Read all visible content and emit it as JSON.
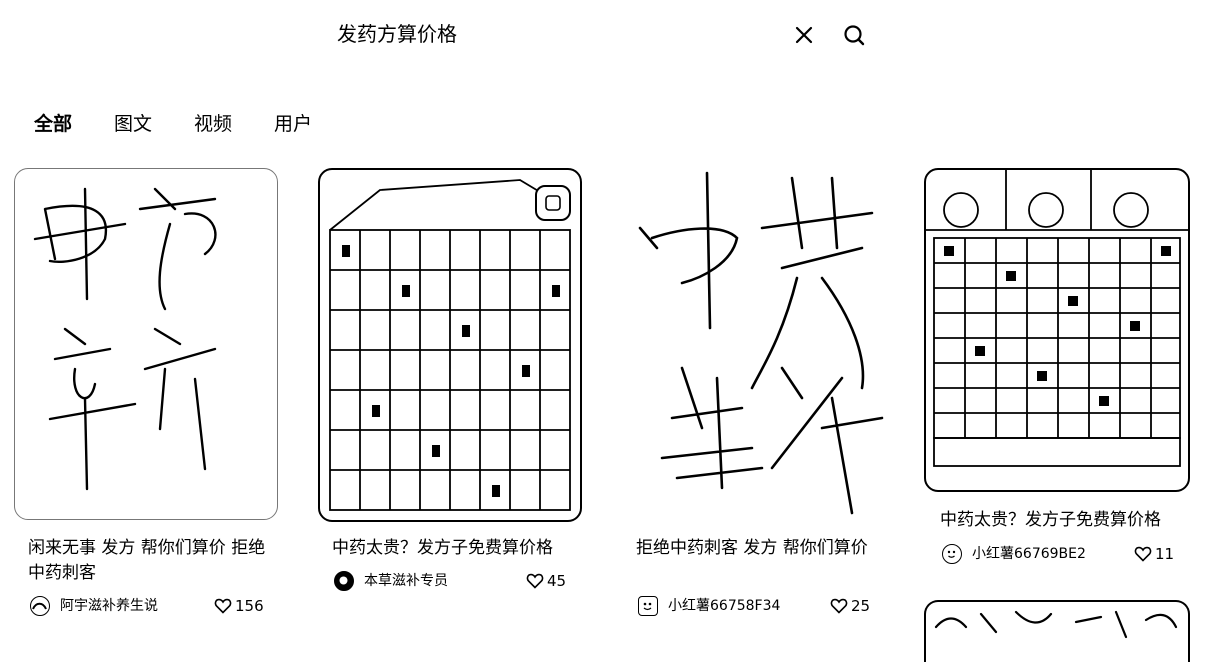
{
  "search": {
    "query": "发药方算价格"
  },
  "tabs": [
    {
      "label": "全部",
      "active": true
    },
    {
      "label": "图文",
      "active": false
    },
    {
      "label": "视频",
      "active": false
    },
    {
      "label": "用户",
      "active": false
    }
  ],
  "cards": [
    {
      "title": "闲来无事 发方 帮你们算价 拒绝中药刺客",
      "author": "阿宇滋补养生说",
      "likes": "156",
      "image": "handwriting-note"
    },
    {
      "title": "中药太贵？发方子免费算价格",
      "author": "本草滋补专员",
      "likes": "45",
      "image": "herb-drawer-cabinet"
    },
    {
      "title": "拒绝中药刺客 发方 帮你们算价",
      "author": "小红薯66758F34",
      "likes": "25",
      "image": "handwriting-note"
    },
    {
      "title": "中药太贵？发方子免费算价格",
      "author": "小红薯66769BE2",
      "likes": "11",
      "image": "herb-drawer-cabinet"
    }
  ],
  "icons": {
    "clear": "close-icon",
    "search": "search-icon",
    "like": "heart-icon"
  },
  "colors": {
    "text": "#000000",
    "background": "#ffffff"
  }
}
